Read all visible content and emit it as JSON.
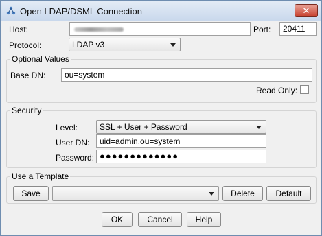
{
  "window": {
    "title": "Open LDAP/DSML Connection",
    "close_glyph": "✕"
  },
  "connection": {
    "host_label": "Host:",
    "host_value": "",
    "port_label": "Port:",
    "port_value": "20411",
    "protocol_label": "Protocol:",
    "protocol_value": "LDAP v3"
  },
  "optional": {
    "title": "Optional Values",
    "base_dn_label": "Base DN:",
    "base_dn_value": "ou=system",
    "read_only_label": "Read Only:",
    "read_only_checked": false
  },
  "security": {
    "title": "Security",
    "level_label": "Level:",
    "level_value": "SSL + User + Password",
    "user_dn_label": "User DN:",
    "user_dn_value": "uid=admin,ou=system",
    "password_label": "Password:",
    "password_mask": "●●●●●●●●●●●●●"
  },
  "template": {
    "title": "Use a Template",
    "save_label": "Save",
    "selected_value": "",
    "delete_label": "Delete",
    "default_label": "Default"
  },
  "footer": {
    "ok_label": "OK",
    "cancel_label": "Cancel",
    "help_label": "Help"
  },
  "icons": {
    "app": "ldap-connection-icon",
    "close": "close-icon",
    "dropdown": "chevron-down-icon"
  },
  "colors": {
    "close_button": "#c7412f",
    "title_bar": "#c9d8ec"
  }
}
